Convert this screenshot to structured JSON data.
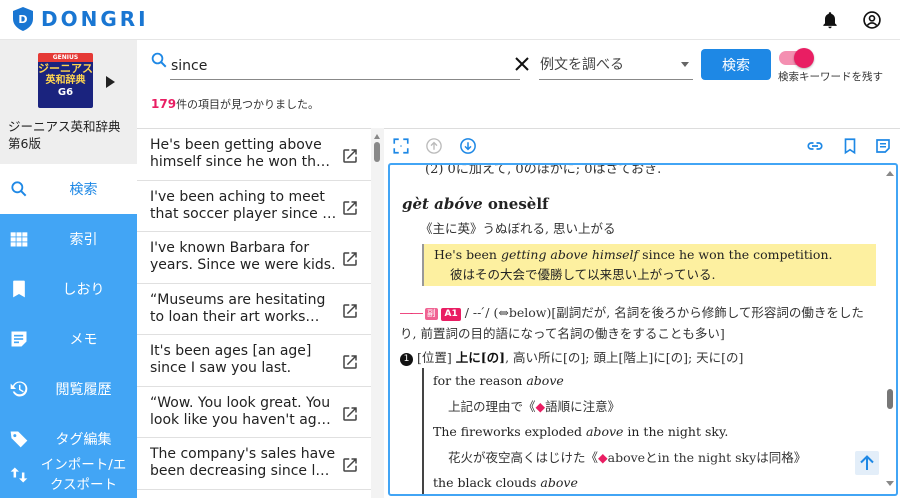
{
  "app": {
    "name": "DONGRI",
    "brand_color": "#1976d2",
    "icons": [
      "notifications-icon",
      "account-icon"
    ]
  },
  "dictionary": {
    "cover": {
      "publisher": "GENIUS",
      "line1": "ジーニアス",
      "line2": "英和辞典",
      "edition": "G6"
    },
    "name": "ジーニアス英和辞典 第6版"
  },
  "nav": [
    {
      "label": "検索",
      "icon": "search-icon",
      "active": true
    },
    {
      "label": "索引",
      "icon": "grid-icon",
      "active": false
    },
    {
      "label": "しおり",
      "icon": "bookmark-icon",
      "active": false
    },
    {
      "label": "メモ",
      "icon": "memo-icon",
      "active": false
    },
    {
      "label": "閲覧履歴",
      "icon": "history-icon",
      "active": false
    },
    {
      "label": "タグ編集",
      "icon": "tag-icon",
      "active": false
    },
    {
      "label": "インポート/エクスポート",
      "icon": "import-export-icon",
      "active": false
    }
  ],
  "search": {
    "query": "since",
    "mode_selected": "例文を調べる",
    "button_label": "検索",
    "toggle_label": "検索キーワードを残す",
    "toggle_on": true,
    "count": "179",
    "count_suffix": "件の項目が見つかりました。"
  },
  "results": [
    "He's been getting above himself since he won the competition.",
    "I've been aching to meet that soccer player since I was a child.",
    "I've known Barbara for years. Since we were kids.",
    "“Museums are hesitating to loan their art works since the pandemic.",
    "It's been ages [an age] since I saw you last.",
    "“Wow. You look great. You look like you haven't aged a bit.",
    "The company's sales have been decreasing since last year."
  ],
  "detail": {
    "cut_line": "(2) 0に加えて, 0のほかに; 0はさておき.",
    "idiom": {
      "head": "gèt abóve",
      "rest": " onesèlf",
      "def": "《主に英》うぬぼれる, 思い上がる"
    },
    "highlight_example": {
      "en_pre": "He's been ",
      "en_italic": "getting above himself",
      "en_post": " since he won the competition.",
      "ja": "彼はその大会で優勝して以来思い上がっている."
    },
    "pos_line": {
      "badge_sub": "副",
      "level": "A1",
      "pron": "/ -- ́/",
      "text": "(⇔below)[副詞だが, 名詞を後ろから修飾して形容詞の働きをしたり, 前置詞の目的語になって名詞の働きをすることも多い]"
    },
    "sense1": {
      "num": "1",
      "pre": "[位置] ",
      "bold": "上に[の]",
      "post": ", 高い所に[の]; 頭上[階上]に[の]; 天に[の]"
    },
    "examples": [
      {
        "en_pre": "for the reason ",
        "en_italic": "above",
        "en_post": ""
      },
      {
        "ja_pre": "上記の理由で《",
        "ja_mark": "◆",
        "ja_post": "語順に注意》"
      },
      {
        "en_pre": "The fireworks exploded ",
        "en_italic": "above",
        "en_post": " in the night sky."
      },
      {
        "ja_pre": "花火が夜空高くはじけた《",
        "ja_mark": "◆",
        "ja_post": "aboveとin the night skyは同格》"
      },
      {
        "en_pre": "the black clouds ",
        "en_italic": "above",
        "en_post": ""
      }
    ]
  },
  "colors": {
    "sidebar": "#42a5f5",
    "accent": "#1e88e5",
    "pink": "#e91e63",
    "highlight": "#fdf0a0"
  }
}
